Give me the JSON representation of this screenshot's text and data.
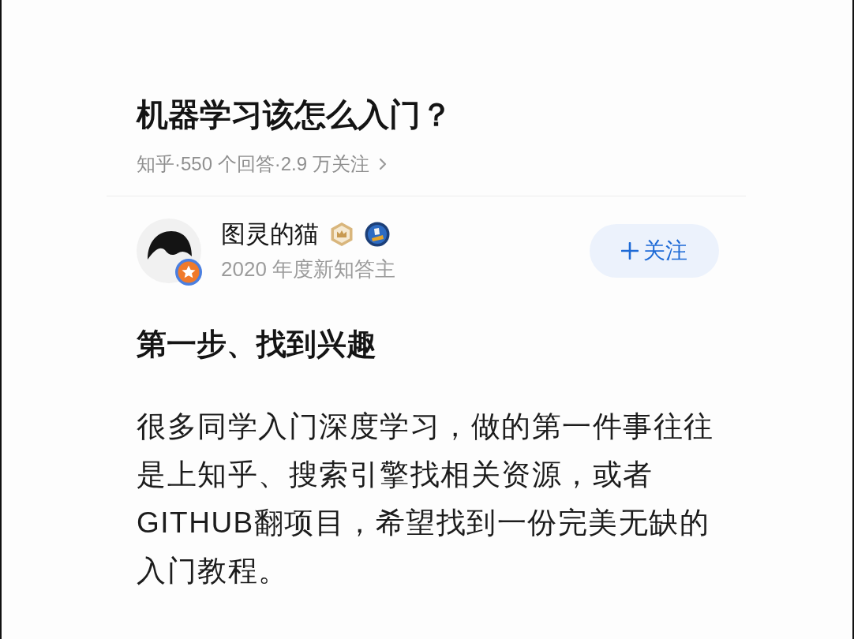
{
  "question": {
    "title": "机器学习该怎么入门？",
    "meta": "知乎·550 个回答·2.9 万关注"
  },
  "author": {
    "name": "图灵的猫",
    "honor": "2020 年度新知答主",
    "follow_label": "关注"
  },
  "answer": {
    "heading": "第一步、找到兴趣",
    "paragraph": "很多同学入门深度学习，做的第一件事往往是上知乎、搜索引擎找相关资源，或者GITHUB翻项目，希望找到一份完美无缺的入门教程。"
  }
}
